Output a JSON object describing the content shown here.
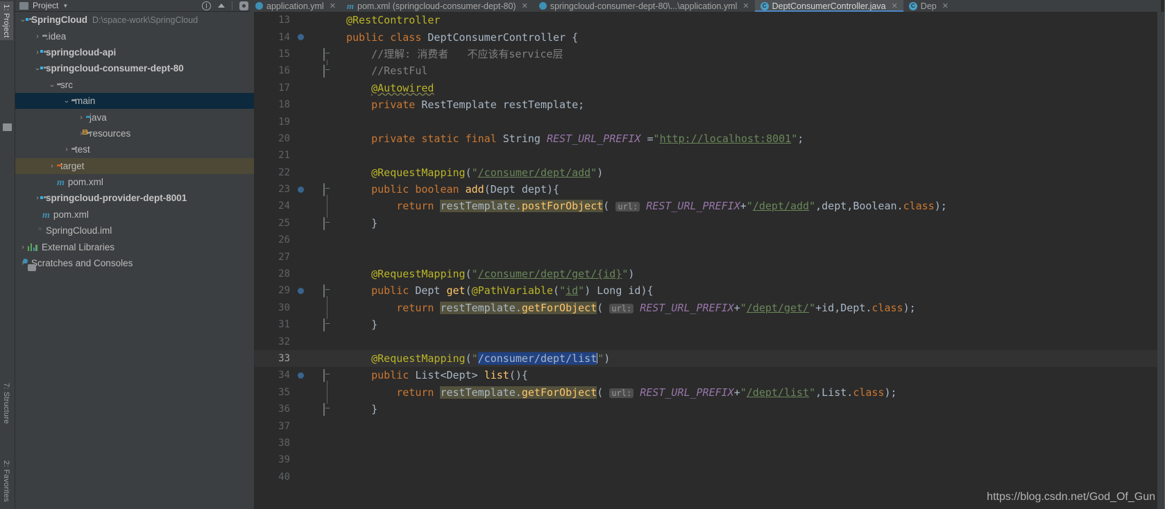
{
  "window": {
    "theme_bg": "#3c3f41",
    "editor_bg": "#2b2b2b",
    "accent": "#4a88c7"
  },
  "tool_strip": {
    "tabs": [
      {
        "label": "1: Project",
        "name": "vtab-project",
        "selected": true
      },
      {
        "label": "7: Structure",
        "name": "vtab-structure",
        "selected": false
      },
      {
        "label": "2: Favorites",
        "name": "vtab-favorites",
        "selected": false
      }
    ]
  },
  "project_panel": {
    "title": "Project",
    "tree": [
      {
        "indent": 0,
        "arrow": "v",
        "icon": "folder-module-badge",
        "label": "SpringCloud",
        "bold": true,
        "path": "D:\\space-work\\SpringCloud",
        "selected": "none"
      },
      {
        "indent": 1,
        "arrow": ">",
        "icon": "folder-plain",
        "label": ".idea",
        "bold": false,
        "path": "",
        "selected": "none"
      },
      {
        "indent": 1,
        "arrow": ">",
        "icon": "folder-module-badge",
        "label": "springcloud-api",
        "bold": true,
        "path": "",
        "selected": "none"
      },
      {
        "indent": 1,
        "arrow": "v",
        "icon": "folder-module-badge",
        "label": "springcloud-consumer-dept-80",
        "bold": true,
        "path": "",
        "selected": "none"
      },
      {
        "indent": 2,
        "arrow": "v",
        "icon": "folder-plain",
        "label": "src",
        "bold": false,
        "path": "",
        "selected": "none"
      },
      {
        "indent": 3,
        "arrow": "v",
        "icon": "folder-plain",
        "label": "main",
        "bold": false,
        "path": "",
        "selected": "blue"
      },
      {
        "indent": 4,
        "arrow": ">",
        "icon": "folder-sources-blue",
        "label": "java",
        "bold": false,
        "path": "",
        "selected": "none"
      },
      {
        "indent": 4,
        "arrow": ">",
        "icon": "folder-resources",
        "label": "resources",
        "bold": false,
        "path": "",
        "selected": "none"
      },
      {
        "indent": 3,
        "arrow": ">",
        "icon": "folder-plain",
        "label": "test",
        "bold": false,
        "path": "",
        "selected": "none"
      },
      {
        "indent": 2,
        "arrow": ">",
        "icon": "folder-excluded-orange",
        "label": "target",
        "bold": false,
        "path": "",
        "selected": "olive"
      },
      {
        "indent": 2,
        "arrow": "",
        "icon": "maven-m-icon",
        "label": "pom.xml",
        "bold": false,
        "path": "",
        "selected": "none"
      },
      {
        "indent": 1,
        "arrow": ">",
        "icon": "folder-module-badge",
        "label": "springcloud-provider-dept-8001",
        "bold": true,
        "path": "",
        "selected": "none"
      },
      {
        "indent": 1,
        "arrow": "",
        "icon": "maven-m-icon",
        "label": "pom.xml",
        "bold": false,
        "path": "",
        "selected": "none"
      },
      {
        "indent": 1,
        "arrow": "",
        "icon": "iml-file-icon",
        "label": "SpringCloud.iml",
        "bold": false,
        "path": "",
        "selected": "none"
      },
      {
        "indent": 0,
        "arrow": ">",
        "icon": "external-libraries-icon",
        "label": "External Libraries",
        "bold": false,
        "path": "",
        "selected": "none"
      },
      {
        "indent": 0,
        "arrow": ">",
        "icon": "scratches-icon",
        "label": "Scratches and Consoles",
        "bold": false,
        "path": "",
        "selected": "none"
      }
    ]
  },
  "editor": {
    "tabs": [
      {
        "label": "application.yml",
        "icon": "yml-file-icon",
        "active": false
      },
      {
        "label": "pom.xml (springcloud-consumer-dept-80)",
        "icon": "maven-m-icon",
        "active": false
      },
      {
        "label": "springcloud-consumer-dept-80\\...\\application.yml",
        "icon": "yml-file-icon",
        "active": false
      },
      {
        "label": "DeptConsumerController.java",
        "icon": "java-class-icon",
        "active": true
      },
      {
        "label": "Dep",
        "icon": "java-class-icon",
        "active": false
      }
    ],
    "first_line_number": 13,
    "current_line_number": 33,
    "lines": [
      {
        "n": 13,
        "marker": "bean",
        "fold": "",
        "text": "@RestController"
      },
      {
        "n": 14,
        "marker": "bean-class",
        "fold": "",
        "text": "public class DeptConsumerController {"
      },
      {
        "n": 15,
        "marker": "",
        "fold": "top",
        "text": "    //理解: 消费者   不应该有service层"
      },
      {
        "n": 16,
        "marker": "",
        "fold": "bot",
        "text": "    //RestFul"
      },
      {
        "n": 17,
        "marker": "",
        "fold": "",
        "text": "    @Autowired"
      },
      {
        "n": 18,
        "marker": "bean-arrow",
        "fold": "",
        "text": "    private RestTemplate restTemplate;"
      },
      {
        "n": 19,
        "marker": "",
        "fold": "",
        "text": ""
      },
      {
        "n": 20,
        "marker": "",
        "fold": "",
        "text": "    private static final String REST_URL_PREFIX =\"http://localhost:8001\";"
      },
      {
        "n": 21,
        "marker": "",
        "fold": "",
        "text": ""
      },
      {
        "n": 22,
        "marker": "",
        "fold": "",
        "text": "    @RequestMapping(\"/consumer/dept/add\")"
      },
      {
        "n": 23,
        "marker": "bean-class",
        "fold": "top",
        "text": "    public boolean add(Dept dept){"
      },
      {
        "n": 24,
        "marker": "",
        "fold": "",
        "text": "        return restTemplate.postForObject( url: REST_URL_PREFIX+\"/dept/add\",dept,Boolean.class);"
      },
      {
        "n": 25,
        "marker": "",
        "fold": "bot",
        "text": "    }"
      },
      {
        "n": 26,
        "marker": "",
        "fold": "",
        "text": ""
      },
      {
        "n": 27,
        "marker": "",
        "fold": "",
        "text": ""
      },
      {
        "n": 28,
        "marker": "",
        "fold": "",
        "text": "    @RequestMapping(\"/consumer/dept/get/{id}\")"
      },
      {
        "n": 29,
        "marker": "bean-class",
        "fold": "top",
        "text": "    public Dept get(@PathVariable(\"id\") Long id){"
      },
      {
        "n": 30,
        "marker": "",
        "fold": "",
        "text": "        return restTemplate.getForObject( url: REST_URL_PREFIX+\"/dept/get/\"+id,Dept.class);"
      },
      {
        "n": 31,
        "marker": "",
        "fold": "bot",
        "text": "    }"
      },
      {
        "n": 32,
        "marker": "",
        "fold": "",
        "text": ""
      },
      {
        "n": 33,
        "marker": "",
        "fold": "",
        "text": "    @RequestMapping(\"/consumer/dept/list\")"
      },
      {
        "n": 34,
        "marker": "bean-class",
        "fold": "top",
        "text": "    public List<Dept> list(){"
      },
      {
        "n": 35,
        "marker": "",
        "fold": "",
        "text": "        return restTemplate.getForObject( url: REST_URL_PREFIX+\"/dept/list\",List.class);"
      },
      {
        "n": 36,
        "marker": "",
        "fold": "bot",
        "text": "    }"
      },
      {
        "n": 37,
        "marker": "",
        "fold": "",
        "text": ""
      },
      {
        "n": 38,
        "marker": "",
        "fold": "",
        "text": ""
      },
      {
        "n": 39,
        "marker": "",
        "fold": "",
        "text": ""
      },
      {
        "n": 40,
        "marker": "",
        "fold": "",
        "text": ""
      }
    ],
    "selection": "/consumer/dept/list",
    "inlay_hint": "url:"
  },
  "watermark": {
    "text": "https://blog.csdn.net/God_Of_Gun"
  }
}
